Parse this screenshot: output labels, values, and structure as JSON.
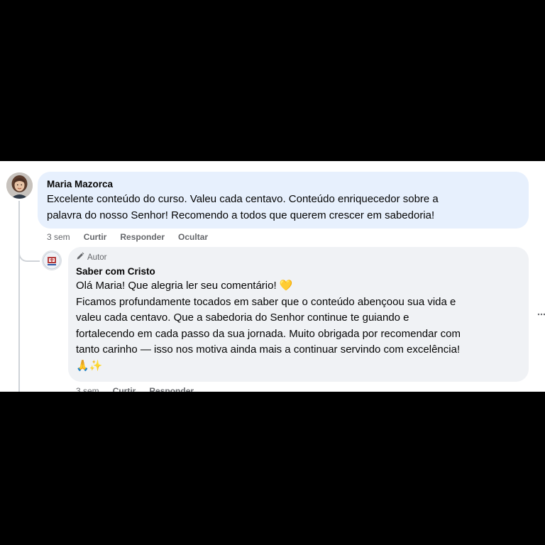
{
  "comment": {
    "author": "Maria Mazorca",
    "text": "Excelente conteúdo do curso. Valeu cada centavo. Conteúdo enriquecedor sobre a\npalavra do nosso Senhor! Recomendo a todos que querem crescer em sabedoria!",
    "time": "3 sem",
    "like_label": "Curtir",
    "reply_label": "Responder",
    "hide_label": "Ocultar"
  },
  "reply": {
    "badge_label": "Autor",
    "author": "Saber com Cristo",
    "text": "Olá Maria! Que alegria ler seu comentário! 💛\nFicamos profundamente tocados em saber que o conteúdo abençoou sua vida e\nvaleu cada centavo. Que a sabedoria do Senhor continue te guiando e\nfortalecendo em cada passo da sua jornada. Muito obrigada por recomendar com\ntanto carinho — isso nos motiva ainda mais a continuar servindo com excelência!\n🙏✨",
    "time": "3 sem",
    "like_label": "Curtir",
    "reply_label": "Responder"
  },
  "icons": {
    "badge": "pen-icon",
    "more": "more-options-icon"
  },
  "colors": {
    "comment_bubble": "#e7f0fd",
    "reply_bubble": "#f0f2f5",
    "secondary_text": "#65676b"
  }
}
